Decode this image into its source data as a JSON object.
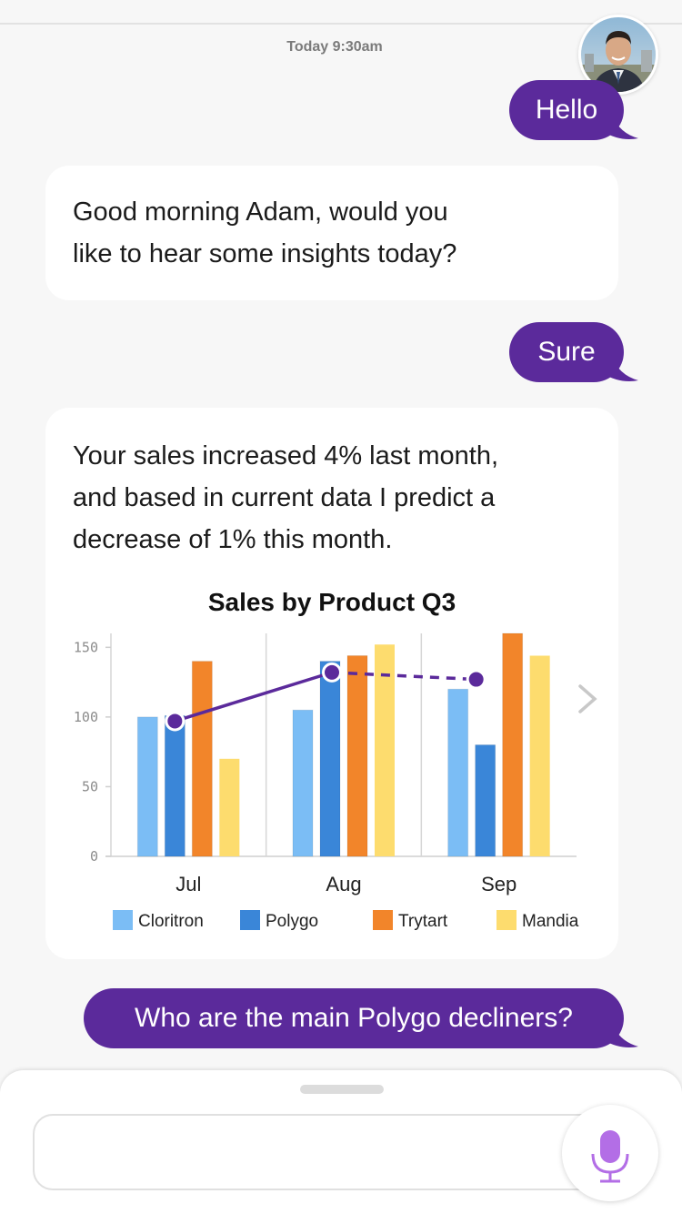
{
  "conversation": {
    "timestamp": "Today 9:30am",
    "messages": [
      {
        "from": "user",
        "text": "Hello"
      },
      {
        "from": "bot",
        "text_lines": [
          "Good morning Adam, would you",
          "like to hear some insights today?"
        ]
      },
      {
        "from": "user",
        "text": "Sure"
      },
      {
        "from": "bot",
        "text_lines": [
          "Your sales increased 4% last month,",
          "and based in current data I predict a",
          "decrease of 1% this month."
        ]
      },
      {
        "from": "user",
        "text": "Who are the main Polygo decliners?"
      }
    ]
  },
  "chart_data": {
    "type": "bar",
    "title": "Sales by Product Q3",
    "categories": [
      "Jul",
      "Aug",
      "Sep"
    ],
    "series": [
      {
        "name": "Cloritron",
        "color": "#7bbdf5",
        "values": [
          100,
          105,
          120
        ]
      },
      {
        "name": "Polygo",
        "color": "#3a86d8",
        "values": [
          101,
          140,
          80
        ]
      },
      {
        "name": "Trytart",
        "color": "#f2852a",
        "values": [
          140,
          144,
          160
        ]
      },
      {
        "name": "Mandia",
        "color": "#fddc6e",
        "values": [
          70,
          152,
          144
        ]
      }
    ],
    "overlay_line": {
      "values": [
        97,
        132,
        127
      ],
      "color": "#5b2a9b",
      "dashed_segments": [
        1
      ]
    },
    "yticks": [
      0,
      50,
      100,
      150
    ],
    "ylim": [
      0,
      160
    ],
    "legend_position": "bottom",
    "grid": false
  },
  "colors": {
    "accent": "#5b2a9b",
    "mic": "#b36ee6"
  },
  "icons": {
    "next": "chevron-right-icon",
    "mic": "microphone-icon"
  }
}
